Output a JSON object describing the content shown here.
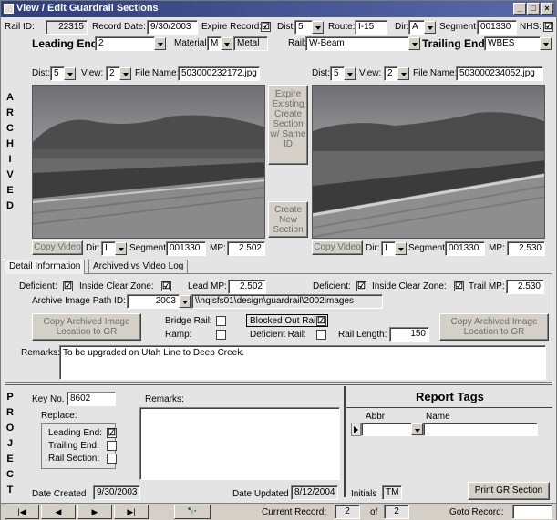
{
  "window": {
    "title": "View / Edit Guardrail Sections",
    "buttons": [
      "_",
      "□",
      "×"
    ]
  },
  "header": {
    "rail_id_label": "Rail ID:",
    "rail_id": "22315",
    "record_date_label": "Record Date:",
    "record_date": "9/30/2003",
    "expire_record_label": "Expire Record:",
    "expire_record_checked": "☑",
    "dist_label": "Dist:",
    "dist": "5",
    "route_label": "Route:",
    "route": "I-15",
    "dir_label": "Dir:",
    "dir": "A",
    "segment_label": "Segment:",
    "segment": "001330",
    "nhs_label": "NHS:",
    "nhs_checked": "☑"
  },
  "ends": {
    "leading_end_label": "Leading End",
    "leading_end": "2",
    "material_label": "Material:",
    "material_code": "M",
    "material_name": "Metal",
    "rail_label": "Rail:",
    "rail": "W-Beam",
    "trailing_end_label": "Trailing End",
    "trailing_end": "WBES"
  },
  "left_photo": {
    "dist_label": "Dist:",
    "dist": "5",
    "view_label": "View:",
    "view": "2",
    "file_name_label": "File Name:",
    "file_name": "503000232172.jpg",
    "copy_video": "Copy Video",
    "dir_label": "Dir:",
    "dir": "I",
    "segment_label": "Segment:",
    "segment": "001330",
    "mp_label": "MP:",
    "mp": "2.502"
  },
  "right_photo": {
    "dist_label": "Dist:",
    "dist": "5",
    "view_label": "View:",
    "view": "2",
    "file_name_label": "File Name:",
    "file_name": "503000234052.jpg",
    "copy_video": "Copy Video",
    "dir_label": "Dir:",
    "dir": "I",
    "segment_label": "Segment:",
    "segment": "001330",
    "mp_label": "MP:",
    "mp": "2.530"
  },
  "middle_buttons": {
    "expire_create": "Expire Existing Create Section w/ Same ID",
    "create_new": "Create New Section"
  },
  "archived_letters": [
    "A",
    "R",
    "C",
    "H",
    "I",
    "V",
    "E",
    "D"
  ],
  "project_letters": [
    "P",
    "R",
    "O",
    "J",
    "E",
    "C",
    "T"
  ],
  "tabs": [
    "Detail Information",
    "Archived vs Video Log"
  ],
  "detail": {
    "deficient_label": "Deficient:",
    "deficient_checked": "☑",
    "inside_clear_zone_label": "Inside Clear Zone:",
    "inside_clear_zone_checked": "☑",
    "lead_mp_label": "Lead MP:",
    "lead_mp": "2.502",
    "deficient2_label": "Deficient:",
    "deficient2_checked": "☑",
    "inside_clear_zone2_label": "Inside Clear Zone:",
    "inside_clear_zone2_checked": "☑",
    "trail_mp_label": "Trail MP:",
    "trail_mp": "2.530",
    "archive_path_label": "Archive Image Path ID:",
    "archive_year": "2003",
    "archive_path": "\\\\hqisfs01\\design\\guardrail\\2002images",
    "copy_archived_left": "Copy Archived Image Location to GR",
    "copy_archived_right": "Copy Archived Image Location to GR",
    "bridge_rail_label": "Bridge Rail:",
    "ramp_label": "Ramp:",
    "blocked_out_label": "Blocked Out Rail:",
    "blocked_out_checked": "☑",
    "deficient_rail_label": "Deficient Rail:",
    "rail_length_label": "Rail Length:",
    "rail_length": "150",
    "remarks_label": "Remarks:",
    "remarks": "To be upgraded on Utah Line to Deep Creek."
  },
  "project": {
    "key_no_label": "Key No.",
    "key_no": "8602",
    "remarks_label": "Remarks:",
    "remarks": "",
    "replace_label": "Replace:",
    "leading_end_label": "Leading End:",
    "leading_end_checked": "☑",
    "trailing_end_label": "Trailing End:",
    "rail_section_label": "Rail Section:",
    "date_created_label": "Date Created",
    "date_created": "9/30/2003",
    "date_updated_label": "Date Updated",
    "date_updated": "8/12/2004",
    "initials_label": "Initials",
    "initials": "TM",
    "print_button": "Print GR Section"
  },
  "report_tags": {
    "title": "Report Tags",
    "col_abbr": "Abbr",
    "col_name": "Name"
  },
  "nav": {
    "first": "|◀",
    "prev": "◀",
    "next": "▶",
    "last": "▶|",
    "find": "🔭",
    "current_record_label": "Current Record:",
    "current": "2",
    "of_label": "of",
    "total": "2",
    "goto_label": "Goto Record:"
  }
}
